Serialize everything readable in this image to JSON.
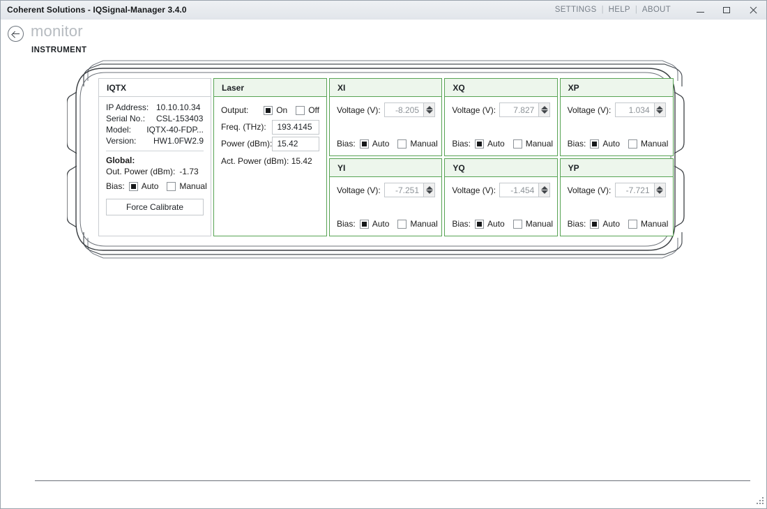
{
  "window": {
    "title": "Coherent Solutions - IQSignal-Manager 3.4.0",
    "menu": [
      "SETTINGS",
      "HELP",
      "ABOUT"
    ],
    "menu_separator": "|",
    "controls": {
      "minimize": "minimize",
      "maximize": "maximize",
      "close": "close"
    }
  },
  "header": {
    "back": "back",
    "title": "monitor",
    "subtitle": "INSTRUMENT"
  },
  "iqtx": {
    "title": "IQTX",
    "info": [
      {
        "label": "IP Address:",
        "value": "10.10.10.34"
      },
      {
        "label": "Serial No.:",
        "value": "CSL-153403"
      },
      {
        "label": "Model:",
        "value": "IQTX-40-FDP..."
      },
      {
        "label": "Version:",
        "value": "HW1.0FW2.9"
      }
    ],
    "global_title": "Global:",
    "out_power_label": "Out. Power (dBm):",
    "out_power_value": "-1.73",
    "bias": {
      "label": "Bias:",
      "auto_label": "Auto",
      "manual_label": "Manual",
      "selected": "Auto"
    },
    "force_calibrate_label": "Force Calibrate"
  },
  "laser": {
    "title": "Laser",
    "output_label": "Output:",
    "on_label": "On",
    "off_label": "Off",
    "output_state": "On",
    "freq_label": "Freq. (THz):",
    "freq_value": "193.4145",
    "power_label": "Power (dBm):",
    "power_value": "15.42",
    "actual_power_text": "Act. Power (dBm): 15.42"
  },
  "channel_common": {
    "voltage_label": "Voltage (V):",
    "bias_label": "Bias:",
    "auto_label": "Auto",
    "manual_label": "Manual",
    "spin_up": "increment",
    "spin_down": "decrement"
  },
  "channels": [
    {
      "id": "XI",
      "title": "XI",
      "voltage": "-8.205",
      "bias_selected": "Auto"
    },
    {
      "id": "XQ",
      "title": "XQ",
      "voltage": "7.827",
      "bias_selected": "Auto"
    },
    {
      "id": "XP",
      "title": "XP",
      "voltage": "1.034",
      "bias_selected": "Auto"
    },
    {
      "id": "YI",
      "title": "YI",
      "voltage": "-7.251",
      "bias_selected": "Auto"
    },
    {
      "id": "YQ",
      "title": "YQ",
      "voltage": "-1.454",
      "bias_selected": "Auto"
    },
    {
      "id": "YP",
      "title": "YP",
      "voltage": "-7.721",
      "bias_selected": "Auto"
    }
  ],
  "colors": {
    "panel_green_border": "#57a353",
    "panel_green_header": "#edf6ec",
    "panel_gray_border": "#c9cdd1",
    "title_gray": "#b6bbc0",
    "chassis_outline": "#3b3f43"
  },
  "statusbar": {
    "resize_grip": "resize-grip"
  }
}
